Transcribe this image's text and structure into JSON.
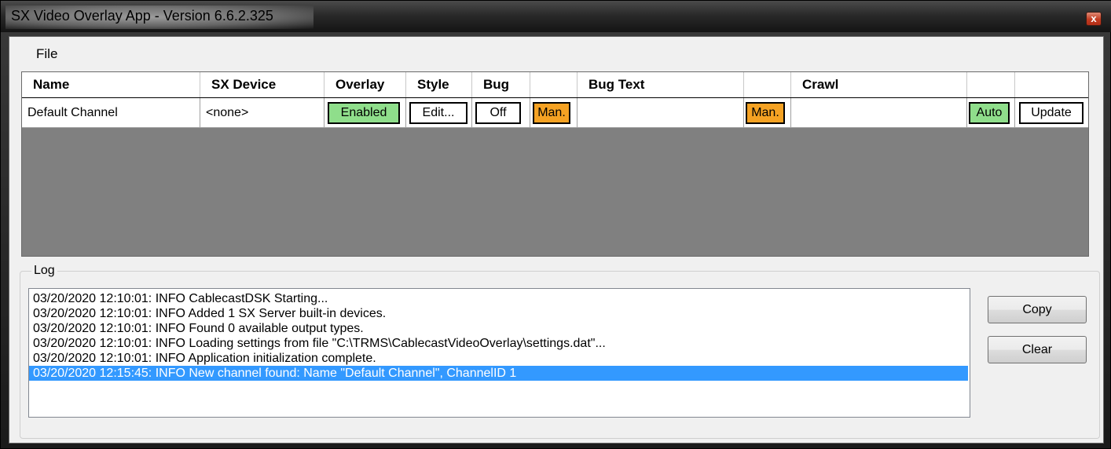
{
  "window": {
    "title": "SX Video Overlay App - Version 6.6.2.325",
    "close_label": "x"
  },
  "menu": {
    "file": "File"
  },
  "grid": {
    "headers": [
      "Name",
      "SX Device",
      "Overlay",
      "Style",
      "Bug",
      "Bug Text",
      "Crawl"
    ],
    "row": {
      "name": "Default Channel",
      "sx_device": "<none>",
      "overlay": "Enabled",
      "style": "Edit...",
      "bug": "Off",
      "bug_mode": "Man.",
      "bug_text": "",
      "bug_text_mode": "Man.",
      "crawl": "",
      "crawl_mode": "Auto",
      "update": "Update"
    }
  },
  "log": {
    "label": "Log",
    "lines": [
      "03/20/2020 12:10:01: INFO  CablecastDSK Starting...",
      "03/20/2020 12:10:01: INFO  Added 1 SX Server built-in devices.",
      "03/20/2020 12:10:01: INFO  Found 0 available output types.",
      "03/20/2020 12:10:01: INFO  Loading settings from file \"C:\\TRMS\\CablecastVideoOverlay\\settings.dat\"...",
      "03/20/2020 12:10:01: INFO  Application initialization complete.",
      "03/20/2020 12:15:45: INFO  New channel found: Name \"Default Channel\", ChannelID 1"
    ],
    "copy_label": "Copy",
    "clear_label": "Clear"
  },
  "colors": {
    "enabled": "#8fde8b",
    "manual": "#f5a223",
    "selection": "#3399ff",
    "grid_background": "#808080"
  }
}
